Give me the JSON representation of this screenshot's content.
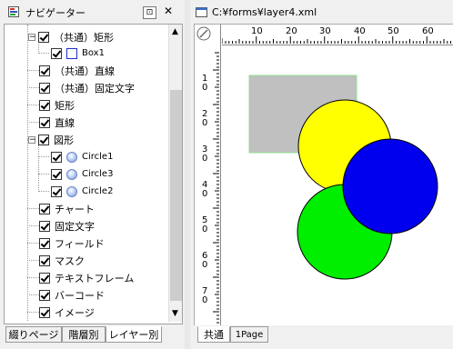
{
  "navigator": {
    "title": "ナビゲーター",
    "pin_glyph": "⊡",
    "close_glyph": "✕",
    "tree": [
      {
        "label": "（共通）矩形",
        "expanded": true
      },
      {
        "label": "Box1"
      },
      {
        "label": "（共通）直線"
      },
      {
        "label": "（共通）固定文字"
      },
      {
        "label": "矩形"
      },
      {
        "label": "直線"
      },
      {
        "label": "図形",
        "expanded": true
      },
      {
        "label": "Circle1"
      },
      {
        "label": "Circle3"
      },
      {
        "label": "Circle2"
      },
      {
        "label": "チャート"
      },
      {
        "label": "固定文字"
      },
      {
        "label": "フィールド"
      },
      {
        "label": "マスク"
      },
      {
        "label": "テキストフレーム"
      },
      {
        "label": "バーコード"
      },
      {
        "label": "イメージ"
      }
    ],
    "tabs": [
      "綴りページ",
      "階層別",
      "レイヤー別"
    ],
    "active_tab": "レイヤー別"
  },
  "document": {
    "title": "C:¥forms¥layer4.xml",
    "h_ruler_labels": [
      "10",
      "20",
      "30",
      "40",
      "50",
      "60"
    ],
    "v_ruler_labels": [
      "1\n0",
      "2\n0",
      "3\n0",
      "4\n0",
      "5\n0",
      "6\n0",
      "7\n0"
    ],
    "tabs": [
      "共通",
      "1Page"
    ],
    "active_tab": "共通",
    "shapes": {
      "box_color": "#c0c0c0",
      "box_border": "#90e090",
      "circle1_color": "#ffff00",
      "circle2_color": "#00ee00",
      "circle3_color": "#0000ee"
    }
  }
}
